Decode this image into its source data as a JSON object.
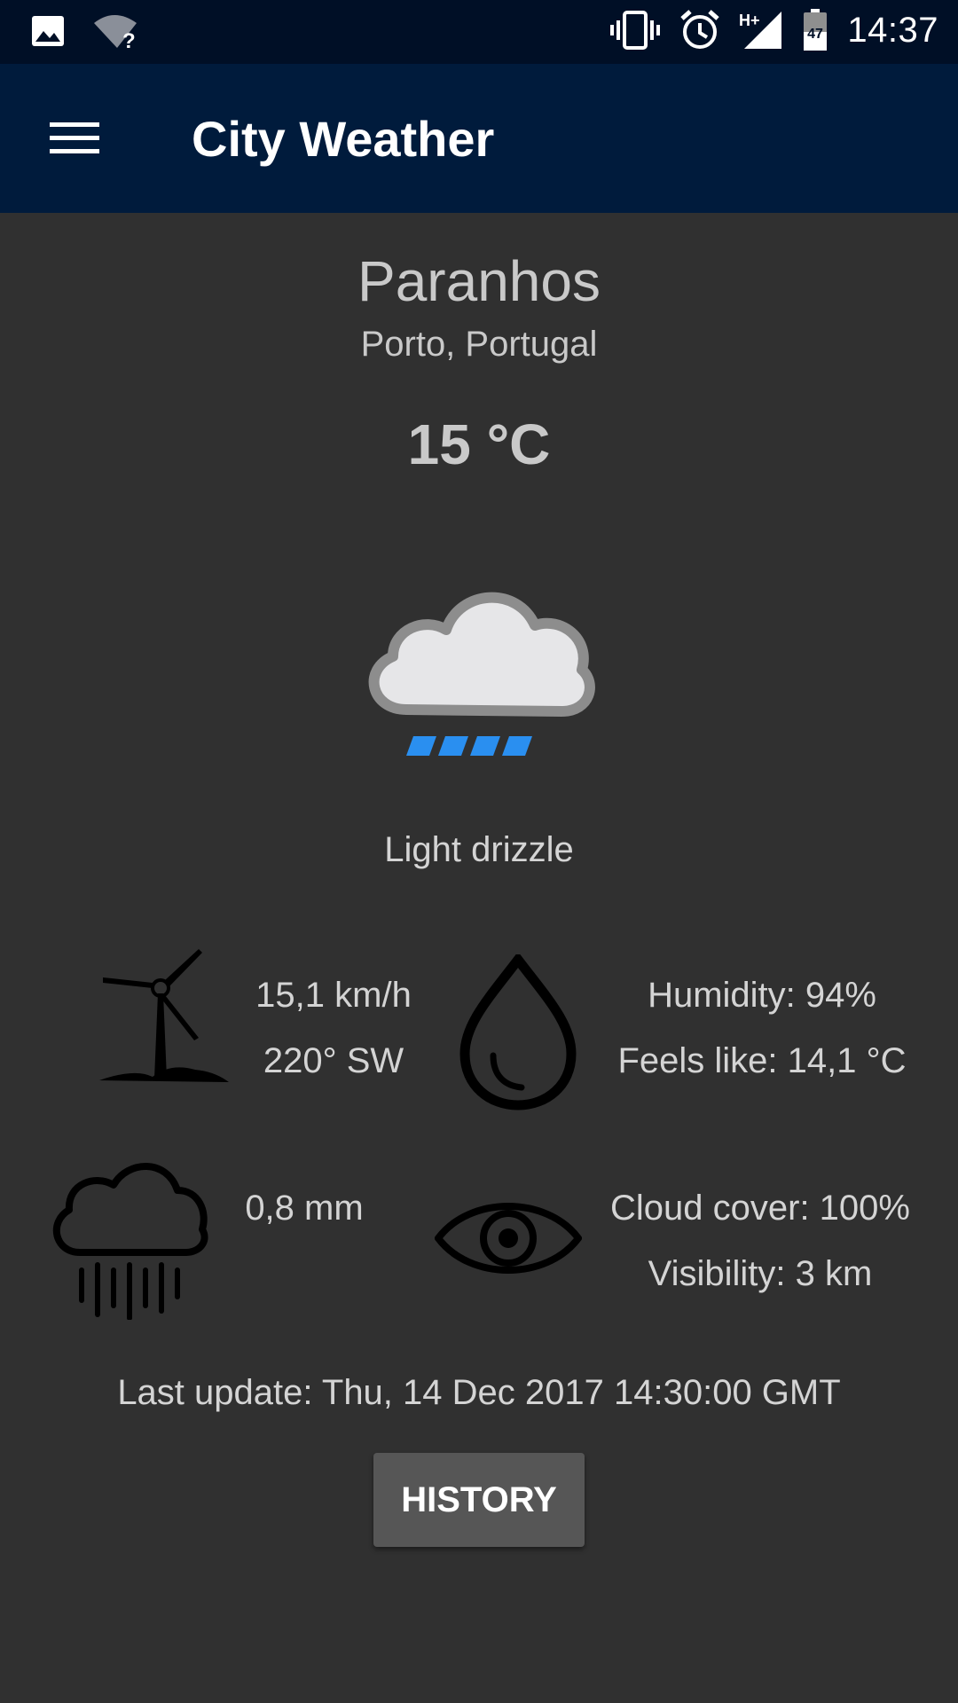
{
  "status_bar": {
    "time": "14:37",
    "battery_level": "47",
    "network_type": "H+",
    "icons": [
      "image-icon",
      "wifi-unknown-icon",
      "vibrate-icon",
      "alarm-icon",
      "signal-icon",
      "battery-icon"
    ]
  },
  "app_bar": {
    "title": "City Weather",
    "menu_icon": "hamburger-menu-icon"
  },
  "location": {
    "city": "Paranhos",
    "region": "Porto, Portugal"
  },
  "current": {
    "temperature": "15 °C",
    "condition": "Light drizzle",
    "condition_icon": "cloud-drizzle-icon"
  },
  "stats": {
    "wind_speed": "15,1 km/h",
    "wind_direction": "220° SW",
    "humidity": "Humidity: 94%",
    "feels_like": "Feels like: 14,1 °C",
    "precipitation": "0,8 mm",
    "cloud_cover": "Cloud cover: 100%",
    "visibility": "Visibility: 3 km"
  },
  "footer": {
    "last_update": "Last update: Thu, 14 Dec 2017 14:30:00 GMT",
    "history_label": "HISTORY"
  },
  "colors": {
    "status_bar": "#000f26",
    "app_bar": "#001b3c",
    "background": "#303030",
    "drizzle_accent": "#2a8ff0",
    "button": "#565656"
  }
}
